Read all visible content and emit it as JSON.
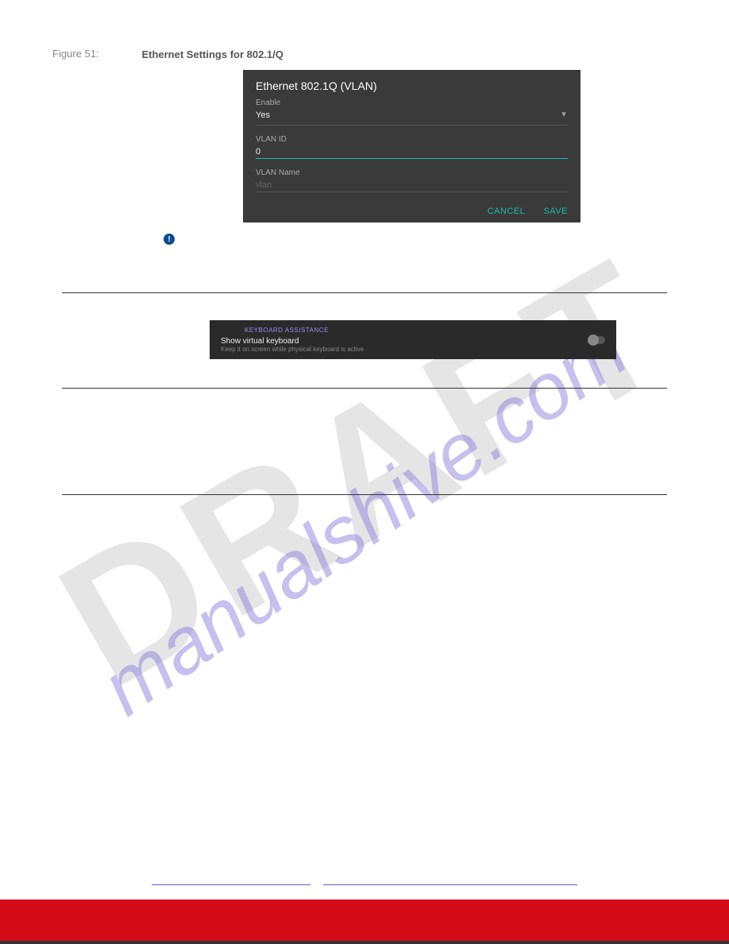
{
  "watermarks": {
    "draft": "DRAFT",
    "url": "manualshive.com"
  },
  "figure": {
    "label": "Figure 51:",
    "title": "Ethernet Settings for 802.1/Q"
  },
  "dialog": {
    "title": "Ethernet 802.1Q (VLAN)",
    "enable_label": "Enable",
    "enable_value": "Yes",
    "vlan_id_label": "VLAN ID",
    "vlan_id_value": "0",
    "vlan_name_label": "VLAN Name",
    "vlan_name_placeholder": "vlan",
    "cancel": "CANCEL",
    "save": "SAVE"
  },
  "notice": {
    "text": ""
  },
  "section1": {
    "title": "",
    "body": ""
  },
  "screenshot2": {
    "header": "KEYBOARD ASSISTANCE",
    "title": "Show virtual keyboard",
    "sub": "Keep it on screen while physical keyboard is active"
  },
  "section2": {
    "title": "",
    "bullets": [
      "",
      "",
      ""
    ]
  },
  "footer": {
    "left": "",
    "right": ""
  }
}
